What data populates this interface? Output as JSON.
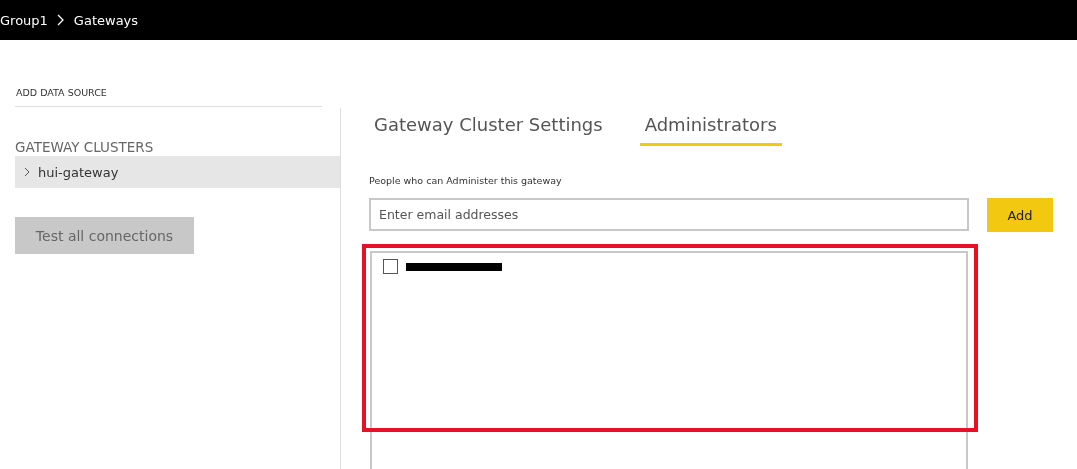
{
  "breadcrumb": [
    "Group1",
    "Gateways"
  ],
  "sidebar": {
    "action": "ADD DATA SOURCE",
    "heading": "GATEWAY CLUSTERS",
    "clusters": [
      {
        "name": "hui-gateway",
        "selected": true
      }
    ],
    "button": "Test all connections"
  },
  "tabs": [
    {
      "label": "Gateway Cluster Settings",
      "selected": false
    },
    {
      "label": "Administrators",
      "selected": true
    }
  ],
  "admins_label": "People who can Administer this gateway",
  "email_field": {
    "placeholder": "Enter email addresses"
  },
  "add_button": "Add",
  "administrators": [
    {
      "checked": false,
      "redacted": true
    }
  ],
  "highlight": true
}
